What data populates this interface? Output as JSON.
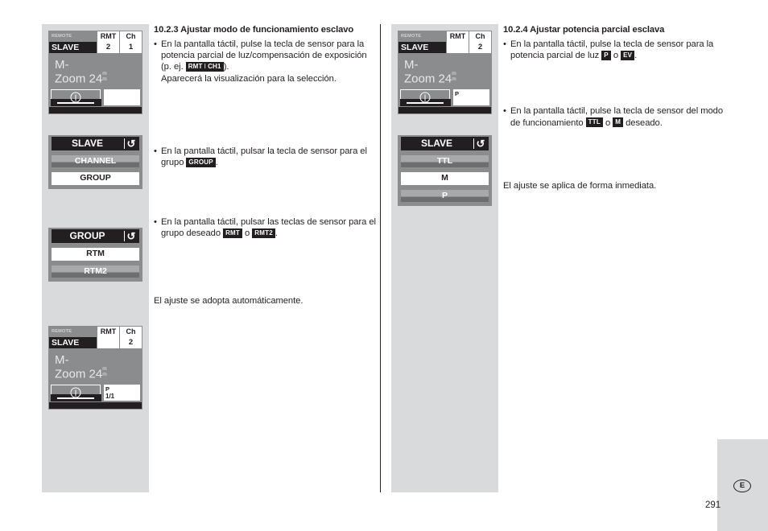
{
  "page": {
    "number": "291",
    "language_badge": "E"
  },
  "left_column": {
    "section": {
      "title": "10.2.3 Ajustar modo de funcionamiento esclavo"
    },
    "bullets": [
      {
        "text_before": "En la pantalla táctil, pulse la tecla de sensor para la potencia parcial de luz/compensación de exposición (p. ej. ",
        "badge": "RMT",
        "badge_sep": "I",
        "badge2": "CH1",
        "text_after": ").",
        "extra_line": "Aparecerá la visualización para la selección."
      },
      {
        "text_before": "En la pantalla táctil, pulsar la tecla de sensor para el grupo ",
        "badge": "GROUP",
        "text_after": "."
      },
      {
        "text_before": "En la pantalla táctil, pulsar las teclas de sensor para el grupo deseado ",
        "badge": "RMT",
        "middle": " o ",
        "badge2": "RMT2",
        "text_after": "."
      }
    ],
    "closing": "El ajuste se adopta automáticamente."
  },
  "right_column": {
    "section": {
      "title": "10.2.4 Ajustar potencia parcial esclava"
    },
    "bullets": [
      {
        "text_before": "En la pantalla táctil, pulse la tecla de sensor para la potencia parcial de luz ",
        "badge": "P",
        "middle": " o ",
        "badge2": "EV",
        "text_after": "."
      },
      {
        "text_before": "En la pantalla táctil, pulse la tecla de sensor del modo de funcionamiento ",
        "badge": "TTL",
        "middle": " o ",
        "badge2": "M",
        "text_after": " deseado."
      }
    ],
    "closing": "El ajuste se aplica de forma inmediata."
  },
  "figures": {
    "left": {
      "lcd_top": {
        "header_label": "REMOTE",
        "header_rmt": "RMT",
        "header_ch": "Ch",
        "mode": "SLAVE",
        "rmt_value": "2",
        "ch_value": "1",
        "body_line1": "M-",
        "body_line2": "Zoom 24",
        "body_unit_top": "m",
        "body_unit_bottom": "m",
        "info_icon": "info-icon",
        "field_label": "",
        "field_value": ""
      },
      "menu_slave": {
        "title": "SLAVE",
        "back_icon": "back-arrow-icon",
        "items": [
          {
            "label": "CHANNEL",
            "selected": false
          },
          {
            "label": "GROUP",
            "selected": true
          }
        ]
      },
      "menu_group": {
        "title": "GROUP",
        "back_icon": "back-arrow-icon",
        "items": [
          {
            "label": "RTM",
            "selected": true
          },
          {
            "label": "RTM2",
            "selected": false
          }
        ]
      },
      "lcd_bottom": {
        "header_label": "REMOTE",
        "header_rmt": "RMT",
        "header_ch": "Ch",
        "mode": "SLAVE",
        "rmt_value": "",
        "ch_value": "2",
        "body_line1": "M-",
        "body_line2": "Zoom 24",
        "body_unit_top": "m",
        "body_unit_bottom": "m",
        "info_icon": "info-icon",
        "field_label": "P",
        "field_value": "1/1"
      }
    },
    "right": {
      "lcd_top": {
        "header_label": "REMOTE",
        "header_rmt": "RMT",
        "header_ch": "Ch",
        "mode": "SLAVE",
        "rmt_value": "",
        "ch_value": "2",
        "body_line1": "M-",
        "body_line2": "Zoom 24",
        "body_unit_top": "m",
        "body_unit_bottom": "m",
        "info_icon": "info-icon",
        "field_label": "P",
        "field_value": ""
      },
      "menu_slave": {
        "title": "SLAVE",
        "back_icon": "back-arrow-icon",
        "items": [
          {
            "label": "TTL",
            "selected": false
          },
          {
            "label": "M",
            "selected": true
          },
          {
            "label": "P",
            "selected": false
          }
        ]
      }
    }
  },
  "colors": {
    "ink": "#231f20",
    "figure_background": "#d9dadb",
    "lcd_gray": "#8b8c8e",
    "menu_item_light": "#a7a9ab",
    "menu_item_dark": "#6d6e70"
  }
}
